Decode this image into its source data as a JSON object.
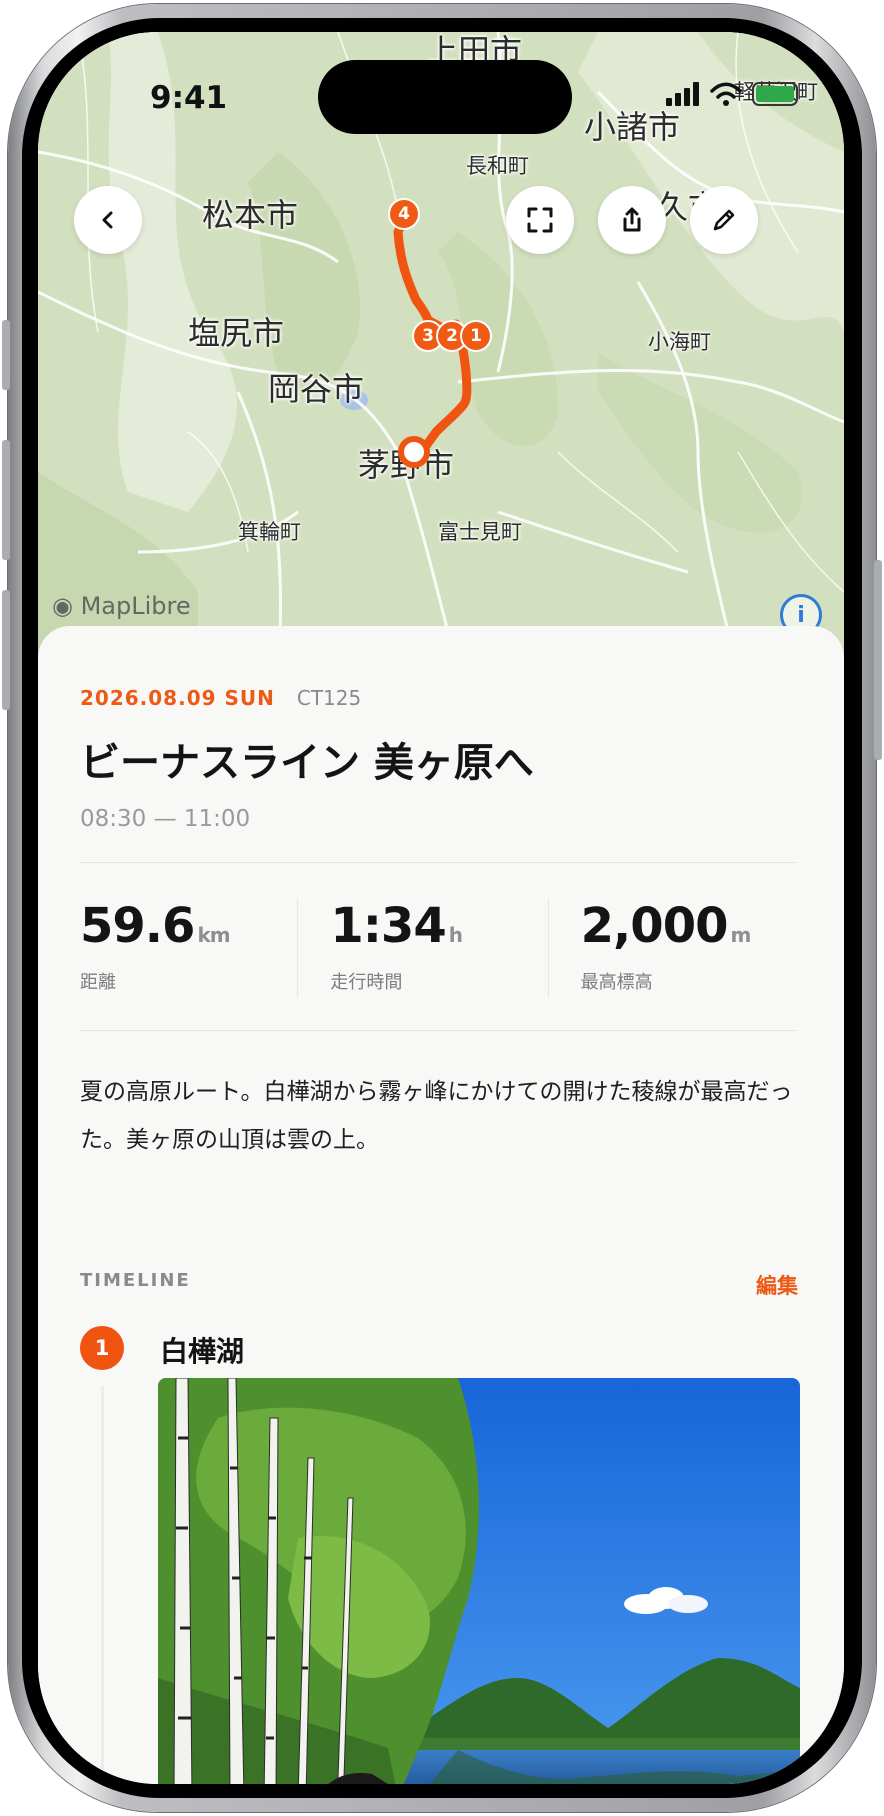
{
  "status_bar": {
    "time": "9:41"
  },
  "map": {
    "labels": {
      "ueda": "上田市",
      "komoro": "小諸市",
      "karuizawa": "軽井沢町",
      "nagawa": "長和町",
      "saku": "佐久市",
      "matsumoto": "松本市",
      "shiojiri": "塩尻市",
      "koumi": "小海町",
      "okaya": "岡谷市",
      "chino": "茅野市",
      "minowa": "箕輪町",
      "fujimi": "富士見町"
    },
    "waypoints": [
      "4",
      "3",
      "2",
      "1"
    ],
    "attribution": "MapLibre",
    "info_glyph": "i",
    "icons": [
      "back-icon",
      "fullscreen-icon",
      "share-icon",
      "edit-icon"
    ]
  },
  "ride": {
    "date": "2026.08.09 SUN",
    "bike": "CT125",
    "title": "ビーナスライン 美ヶ原へ",
    "time_range": "08:30 — 11:00",
    "stats": [
      {
        "value": "59.6",
        "unit": "km",
        "label": "距離"
      },
      {
        "value": "1:34",
        "unit": "h",
        "label": "走行時間"
      },
      {
        "value": "2,000",
        "unit": "m",
        "label": "最高標高"
      }
    ],
    "note": "夏の高原ルート。白樺湖から霧ヶ峰にかけての開けた稜線が最高だった。美ヶ原の山頂は雲の上。"
  },
  "timeline": {
    "label": "TIMELINE",
    "edit_label": "編集",
    "items": [
      {
        "number": "1",
        "title": "白樺湖"
      }
    ]
  },
  "colors": {
    "accent": "#EC5A16",
    "route": "#F05A14"
  }
}
